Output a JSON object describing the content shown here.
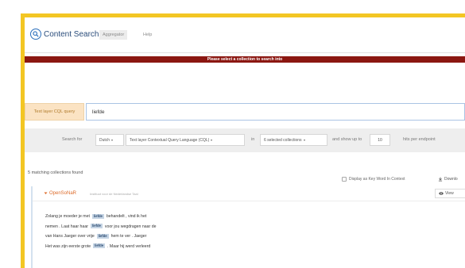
{
  "navbar": {
    "brand_title": "Content Search",
    "tabs": [
      {
        "label": "Aggregator",
        "active": true
      },
      {
        "label": "Help",
        "active": false
      }
    ]
  },
  "alert": {
    "message": "Please select a collection to search into"
  },
  "query": {
    "label": "Text layer CQL query",
    "value": "liefde"
  },
  "search_panel": {
    "search_for": "Search for",
    "language": "Dutch",
    "query_type": "Text layer Contextual Query Language (CQL)",
    "in": "in",
    "collections": "6 selected collections",
    "and_show_up_to": "and show up to",
    "max_hits": "10",
    "hits_per_endpoint": "hits per endpoint"
  },
  "results": {
    "count_text": "5 matching collections found",
    "kwic_label": "Display as Key Word In Context",
    "download_label": "Downlo",
    "corpus": {
      "name": "OpenSoNaR",
      "institute": "Instituut voor de Nederlandse Taal",
      "view_label": "View"
    },
    "lines": [
      {
        "left": "Zolang je moeder je met",
        "keyword": "liefde",
        "right": "behandelt , vind ik het"
      },
      {
        "left": "nemen . Laat haar haar",
        "keyword": "liefde",
        "right": "voor jou wegdragen naar de"
      },
      {
        "left": "van Hans Jaeger over vrije",
        "keyword": "liefde",
        "right": "hem te ver . Jaeger"
      },
      {
        "left": "Het was zijn eerste grote",
        "keyword": "liefde",
        "right": ". Maar hij werd verleerd"
      }
    ]
  },
  "colors": {
    "frame_accent": "#f3c623",
    "alert_bg": "#8b1711",
    "brand": "#2a4c7a",
    "corpus_name": "#dd6b2a",
    "keyword_bg": "#c5d4e4"
  }
}
